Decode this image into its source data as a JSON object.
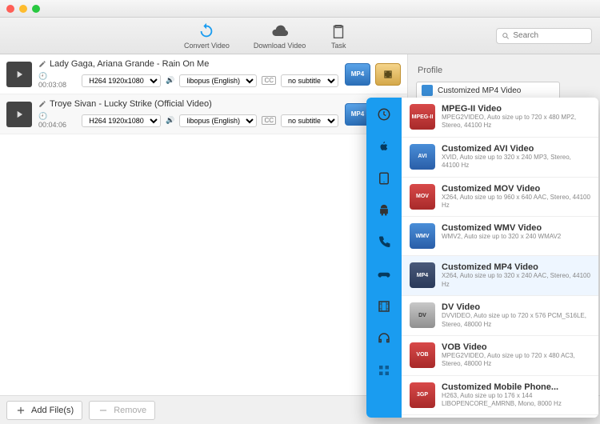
{
  "toolbar": {
    "convert_label": "Convert Video",
    "download_label": "Download Video",
    "task_label": "Task",
    "search_placeholder": "Search"
  },
  "videos": [
    {
      "title": "Lady Gaga, Ariana Grande - Rain On Me",
      "duration": "00:03:08",
      "format": "H264 1920x1080",
      "audio": "libopus (English)",
      "subtitle": "no subtitle",
      "cc": "CC"
    },
    {
      "title": "Troye Sivan - Lucky Strike (Official Video)",
      "duration": "00:04:06",
      "format": "H264 1920x1080",
      "audio": "libopus (English)",
      "subtitle": "no subtitle",
      "cc": "CC"
    }
  ],
  "right": {
    "profile_label": "Profile",
    "selected_profile": "Customized MP4 Video"
  },
  "bottom": {
    "add_label": "Add File(s)",
    "remove_label": "Remove"
  },
  "profiles": [
    {
      "name": "MPEG-II Video",
      "desc": "MPEG2VIDEO, Auto size up to 720 x 480\nMP2, Stereo, 44100 Hz",
      "cls": "pi-mpeg",
      "badge": "MPEG-II"
    },
    {
      "name": "Customized AVI Video",
      "desc": "XVID, Auto size up to 320 x 240\nMP3, Stereo, 44100 Hz",
      "cls": "pi-avi",
      "badge": "AVI"
    },
    {
      "name": "Customized MOV Video",
      "desc": "X264, Auto size up to 960 x 640\nAAC, Stereo, 44100 Hz",
      "cls": "pi-mov",
      "badge": "MOV"
    },
    {
      "name": "Customized WMV Video",
      "desc": "WMV2, Auto size up to 320 x 240\nWMAV2",
      "cls": "pi-wmv",
      "badge": "WMV"
    },
    {
      "name": "Customized MP4 Video",
      "desc": "X264, Auto size up to 320 x 240\nAAC, Stereo, 44100 Hz",
      "cls": "pi-mp4",
      "badge": "MP4",
      "selected": true
    },
    {
      "name": "DV Video",
      "desc": "DVVIDEO, Auto size up to 720 x 576\nPCM_S16LE, Stereo, 48000 Hz",
      "cls": "pi-dv",
      "badge": "DV"
    },
    {
      "name": "VOB Video",
      "desc": "MPEG2VIDEO, Auto size up to 720 x 480\nAC3, Stereo, 48000 Hz",
      "cls": "pi-vob",
      "badge": "VOB"
    },
    {
      "name": "Customized Mobile Phone...",
      "desc": "H263, Auto size up to 176 x 144\nLIBOPENCORE_AMRNB, Mono, 8000 Hz",
      "cls": "pi-3gp",
      "badge": "3GP"
    }
  ],
  "sidebar_categories": [
    "recent",
    "apple",
    "tablet",
    "android",
    "phone",
    "gamepad",
    "film",
    "audio",
    "more"
  ]
}
